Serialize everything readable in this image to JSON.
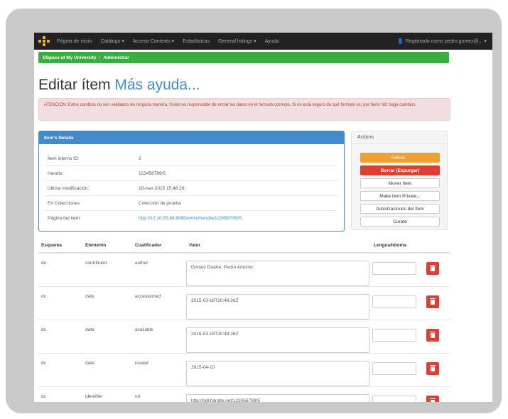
{
  "navbar": {
    "items": [
      "Página de inicio",
      "Catálogo ▾",
      "Acceso Contexto ▾",
      "Estadísticas",
      "General listings ▾",
      "Ayuda"
    ],
    "user": "Registrado como pedro.gomez@... ▾"
  },
  "breadcrumb": {
    "home": "DSpace at My University",
    "current": "Administrar"
  },
  "page": {
    "title": "Editar ítem",
    "help_link": "Más ayuda..."
  },
  "alert": {
    "text": "ATENCIÓN: Estos cambios no son validados de ninguna manera. Usted es responsable de entrar los datos en el formato correcto. Si no está seguro de qué formato es, por favor NO haga cambios."
  },
  "item_details": {
    "heading": "Item's Details",
    "rows": [
      {
        "label": "Ítem interno ID:",
        "value": "2"
      },
      {
        "label": "Handle:",
        "value": "123456789/5"
      },
      {
        "label": "Última modificación:",
        "value": "18-mar-2015 15:48:26"
      },
      {
        "label": "En Colecciones:",
        "value": "Colección de prueba"
      },
      {
        "label": "Página del ítem:",
        "value": "http://10.10.55.68:8080/xmlui/handle/123456789/5"
      }
    ]
  },
  "actions": {
    "heading": "Actions",
    "buttons": [
      "Retirar...",
      "Borrar (Expurgar)",
      "Mover ítem",
      "Make item Private...",
      "Autorizaciones del ítem",
      "Curate"
    ]
  },
  "metadata": {
    "headers": {
      "schema": "Esquema",
      "element": "Elemento",
      "qualifier": "Cualificador",
      "value": "Valor",
      "language": "Lengua/Idioma"
    },
    "rows": [
      {
        "schema": "dc",
        "element": "contributor",
        "qualifier": "author",
        "value": "Gomez Duarte, Pedro Antonio"
      },
      {
        "schema": "dc",
        "element": "date",
        "qualifier": "accessioned",
        "value": "2015-03-18T20:48:26Z"
      },
      {
        "schema": "dc",
        "element": "date",
        "qualifier": "available",
        "value": "2015-03-18T20:48:26Z"
      },
      {
        "schema": "dc",
        "element": "date",
        "qualifier": "issued",
        "value": "2015-04-10"
      },
      {
        "schema": "dc",
        "element": "identifier",
        "qualifier": "uri",
        "value": "http://hdl.handle.net/123456789/5"
      }
    ]
  },
  "colors": {
    "navbar": "#222222",
    "breadcrumb": "#3cab44",
    "primary": "#428bca",
    "danger": "#d9403a",
    "warning": "#f0a030",
    "frame": "#c9c9c9"
  },
  "icons": {
    "logo": "dspace-logo-icon",
    "user": "user-icon",
    "delete": "trash-icon"
  }
}
